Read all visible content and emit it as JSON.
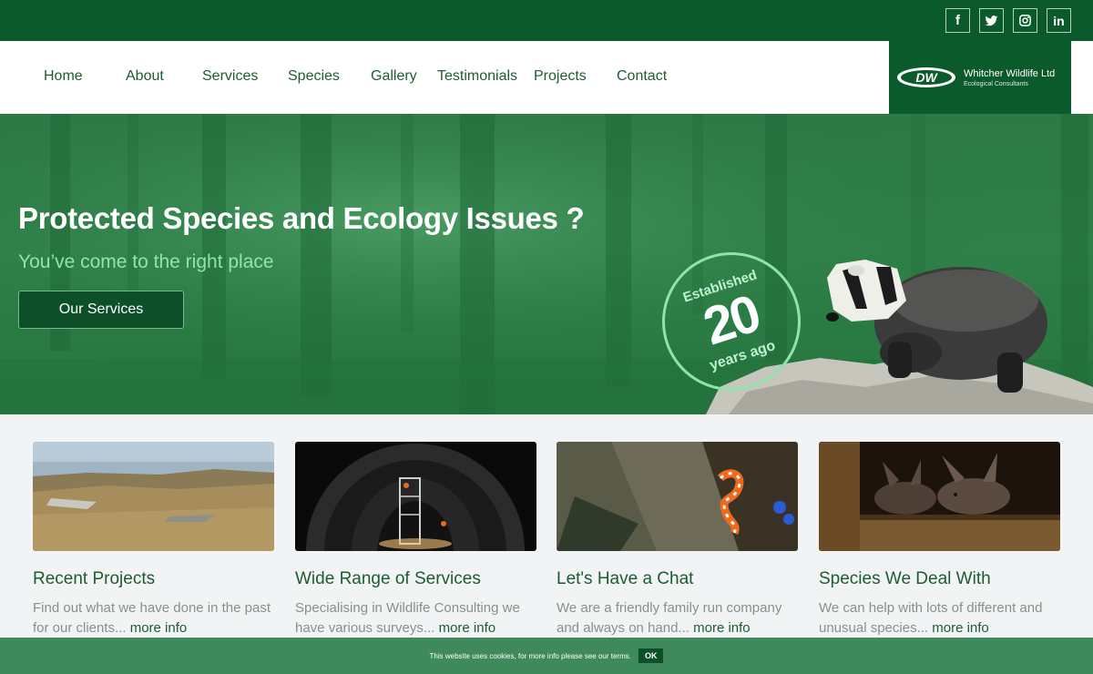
{
  "social": {
    "items": [
      {
        "name": "facebook",
        "glyph": "f"
      },
      {
        "name": "twitter",
        "glyph": ""
      },
      {
        "name": "instagram",
        "glyph": ""
      },
      {
        "name": "linkedin",
        "glyph": "in"
      }
    ]
  },
  "nav": {
    "items": [
      "Home",
      "About",
      "Services",
      "Species",
      "Gallery",
      "Testimonials",
      "Projects",
      "Contact"
    ]
  },
  "logo": {
    "mark": "DW",
    "name": "Whitcher Wildlife Ltd",
    "tagline": "Ecological Consultants"
  },
  "hero": {
    "title": "Protected Species and Ecology Issues ?",
    "subtitle": "You’ve come to the right place",
    "button": "Our Services",
    "badge_top": "Established",
    "badge_number": "20",
    "badge_bottom": "years ago"
  },
  "cards": [
    {
      "title": "Recent Projects",
      "text": "Find out what we have done in the past for our clients...",
      "more": "more info"
    },
    {
      "title": "Wide Range of Services",
      "text": "Specialising in Wildlife Consulting we have various surveys...",
      "more": "more info"
    },
    {
      "title": "Let's Have a Chat",
      "text": "We are a friendly family run company and always on hand...",
      "more": "more info"
    },
    {
      "title": "Species We Deal With",
      "text": "We can help with lots of different and unusual species...",
      "more": "more info"
    }
  ],
  "cookie": {
    "text": "This website uses cookies, for more info please see our terms.",
    "ok": "OK"
  },
  "colors": {
    "brand_dark": "#0b5a2c",
    "accent_light": "#8fe3ad",
    "cookie_bar": "#3f8a5d"
  }
}
